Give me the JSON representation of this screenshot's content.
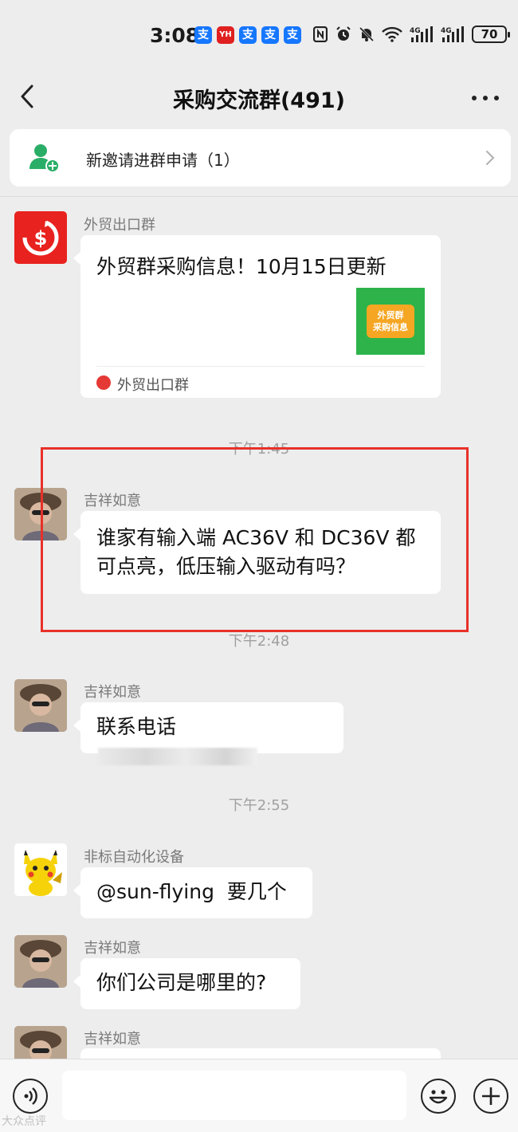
{
  "status_bar": {
    "time": "3:08",
    "app_icons": [
      {
        "name": "alipay-icon",
        "glyph": "支",
        "color": "#1677ff"
      },
      {
        "name": "app-red-icon",
        "glyph": "YH",
        "color": "#e02020"
      },
      {
        "name": "alipay-icon",
        "glyph": "支",
        "color": "#1677ff"
      },
      {
        "name": "alipay-icon",
        "glyph": "支",
        "color": "#1677ff"
      },
      {
        "name": "alipay-icon",
        "glyph": "支",
        "color": "#1677ff"
      }
    ],
    "network_1": "4G",
    "network_2": "4G",
    "battery": "70"
  },
  "header": {
    "title": "采购交流群(491)"
  },
  "invite": {
    "label": "新邀请进群申请（1）"
  },
  "messages": {
    "m1": {
      "sender": "外贸出口群",
      "share_title": "外贸群采购信息！10月15日更新",
      "thumb_line1": "外贸群",
      "thumb_line2": "采购信息",
      "source": "外贸出口群"
    },
    "t1": "下午1:45",
    "m2": {
      "sender": "吉祥如意",
      "text": "谁家有输入端 AC36V 和 DC36V 都\n可点亮，低压输入驱动有吗？"
    },
    "t2": "下午2:48",
    "m3": {
      "sender": "吉祥如意",
      "text": "联系电话"
    },
    "t3": "下午2:55",
    "m4": {
      "sender": "非标自动化设备",
      "text": "@sun-flying  要几个"
    },
    "m5": {
      "sender": "吉祥如意",
      "text": "你们公司是哪里的?"
    },
    "m6": {
      "sender": "吉祥如意"
    }
  },
  "watermark": "大众点评",
  "colors": {
    "background": "#ededed",
    "highlight_box": "#e8312a",
    "invite_icon": "#2aae67"
  }
}
